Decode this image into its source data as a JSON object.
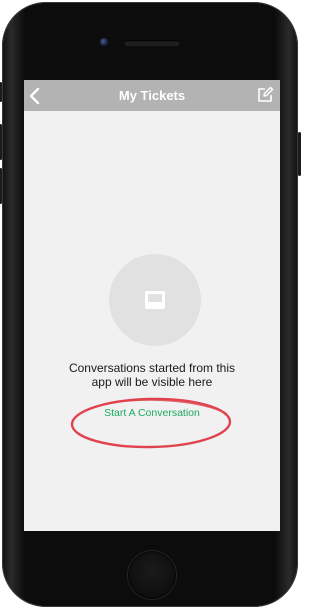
{
  "navbar": {
    "title": "My Tickets",
    "back_icon": "chevron-left-icon",
    "compose_icon": "compose-icon",
    "color": "#b3b3b3"
  },
  "empty_state": {
    "icon": "inbox-icon",
    "message_line1": "Conversations started from this",
    "message_line2": "app will be visible here",
    "action_label": "Start A Conversation",
    "action_color": "#1aaa5f"
  },
  "annotation": {
    "color": "#e0434d"
  }
}
